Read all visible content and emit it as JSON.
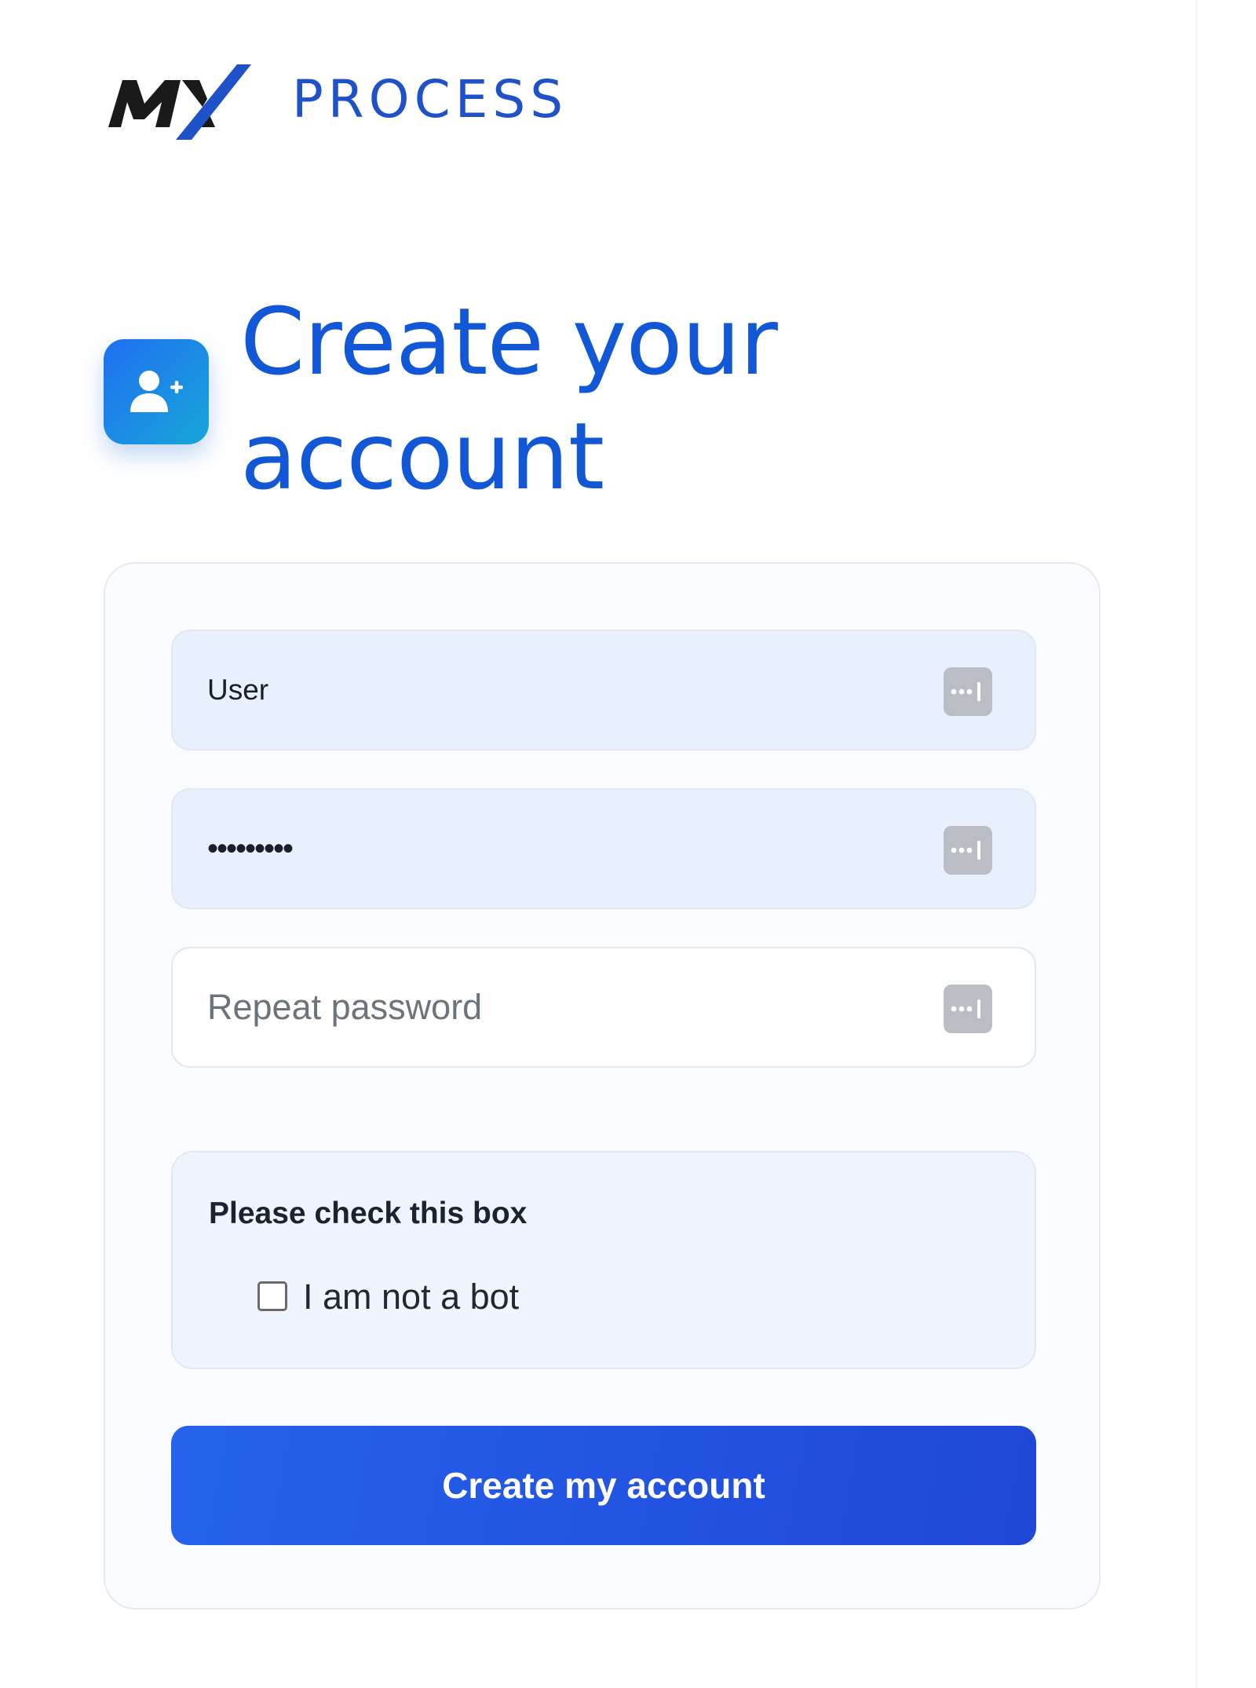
{
  "logo": {
    "mx_text": "MX",
    "process_text": "PROCESS"
  },
  "heading": {
    "icon": "user-plus-icon",
    "title": "Create your account"
  },
  "form": {
    "username": {
      "value": "User",
      "icon": "password-manager-icon"
    },
    "password": {
      "value": "•••••••••",
      "icon": "password-manager-icon"
    },
    "repeat_password": {
      "placeholder": "Repeat password",
      "value": "",
      "icon": "password-manager-icon"
    },
    "captcha": {
      "title": "Please check this box",
      "checkbox_label": "I am not a bot",
      "checked": false
    },
    "submit_label": "Create my account"
  },
  "colors": {
    "accent": "#1258d6",
    "button": "#2563eb",
    "logo_dark": "#1a1a1a",
    "logo_blue": "#1f52c8",
    "field_fill": "#e8f0fd",
    "captcha_fill": "#eef5fe"
  }
}
